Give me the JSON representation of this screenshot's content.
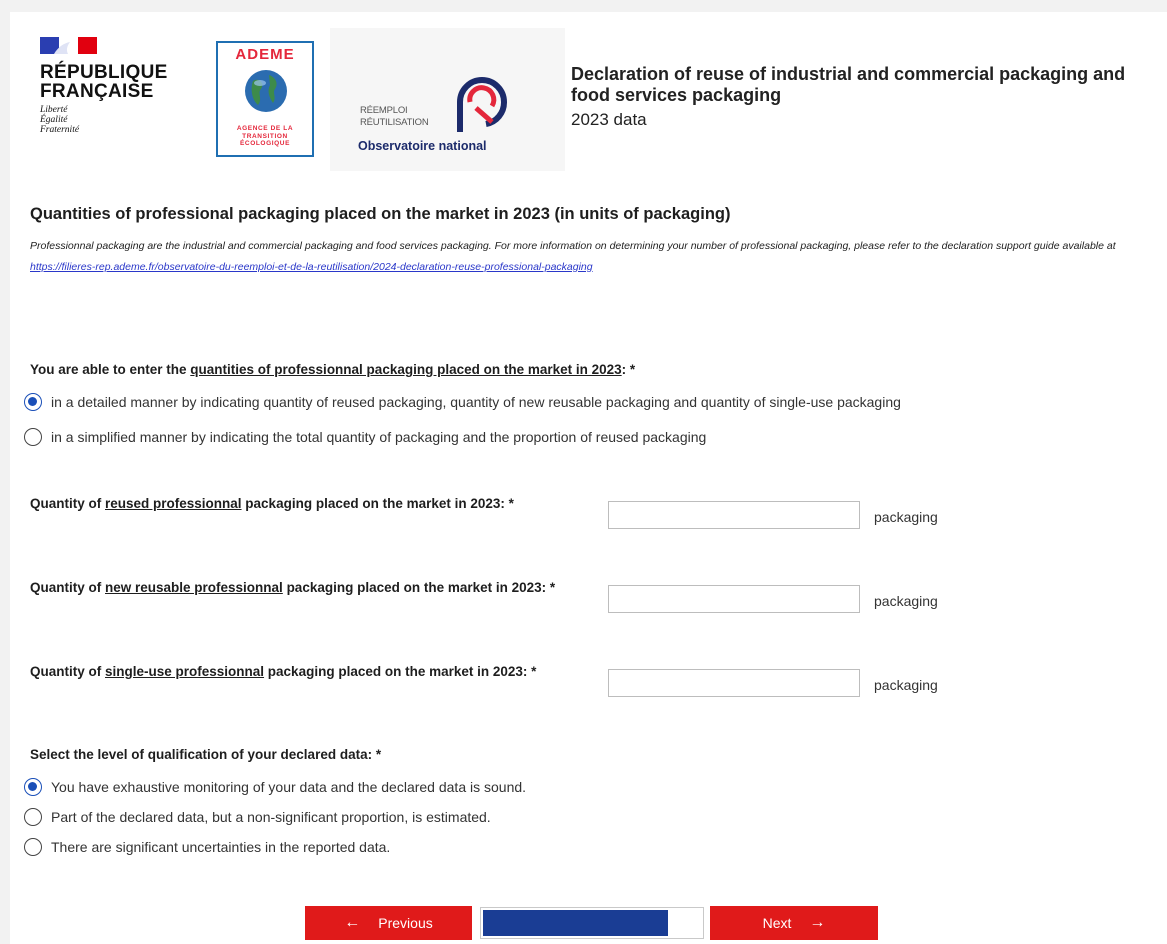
{
  "header": {
    "republique": {
      "name_line1": "RÉPUBLIQUE",
      "name_line2": "FRANÇAISE",
      "motto": [
        "Liberté",
        "Égalité",
        "Fraternité"
      ]
    },
    "ademe": {
      "name": "ADEME",
      "tagline": [
        "AGENCE DE LA",
        "TRANSITION",
        "ÉCOLOGIQUE"
      ]
    },
    "observatoire": {
      "reemploi": "RÉEMPLOI",
      "reutilisation": "RÉUTILISATION",
      "name": "Observatoire national"
    },
    "title": "Declaration of reuse of industrial and commercial packaging and food services packaging",
    "year_label": "2023 data"
  },
  "section": {
    "title": "Quantities of professional packaging placed on the market in 2023 (in units of packaging)",
    "info_text": "Professionnal packaging are the industrial and commercial packaging and food services packaging. For more information on determining your number of professional packaging, please refer to the declaration support guide available at ",
    "info_link": "https://filieres-rep.ademe.fr/observatoire-du-reemploi-et-de-la-reutilisation/2024-declaration-reuse-professional-packaging"
  },
  "entry_mode": {
    "question_prefix": "You are able to enter the ",
    "question_underlined": "quantities of professionnal packaging placed on the market in 2023",
    "question_suffix": ": *",
    "options": [
      {
        "label": "in a detailed manner by indicating quantity of reused packaging, quantity of new reusable packaging and quantity of single-use packaging",
        "checked": true
      },
      {
        "label": "in a simplified manner by indicating the total quantity of packaging and the proportion of reused packaging",
        "checked": false
      }
    ]
  },
  "fields": [
    {
      "prefix": "Quantity of ",
      "underlined": "reused professionnal",
      "suffix": " packaging placed on the market in 2023: *",
      "value": "",
      "unit": "packaging"
    },
    {
      "prefix": "Quantity of ",
      "underlined": "new reusable professionnal",
      "suffix": " packaging placed on the market in 2023: *",
      "value": "",
      "unit": "packaging"
    },
    {
      "prefix": "Quantity of ",
      "underlined": "single-use professionnal",
      "suffix": " packaging placed on the market in 2023: *",
      "value": "",
      "unit": "packaging"
    }
  ],
  "qualification": {
    "question": "Select the level of qualification of your declared data: *",
    "options": [
      {
        "label": "You have exhaustive monitoring of your data and the declared data is sound.",
        "checked": true
      },
      {
        "label": "Part of the declared data, but a non-significant proportion, is estimated.",
        "checked": false
      },
      {
        "label": "There are significant uncertainties in the reported data.",
        "checked": false
      }
    ]
  },
  "navigation": {
    "previous_label": "Previous",
    "next_label": "Next",
    "previous_icon": "arrow-left-icon",
    "next_icon": "arrow-right-icon",
    "progress_percent": 85,
    "progress_color": "#1a3d94",
    "button_color": "#e01a1a"
  }
}
